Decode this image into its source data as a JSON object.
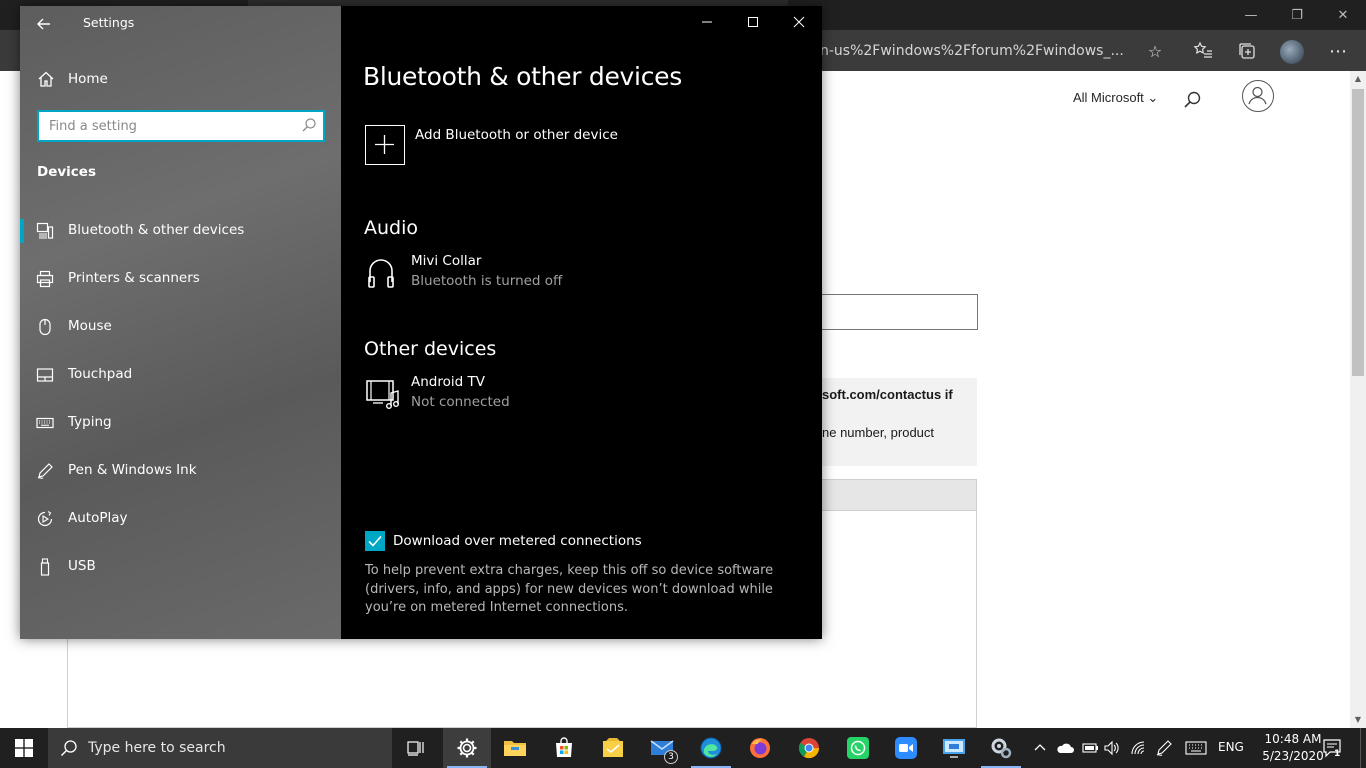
{
  "browser": {
    "address_text": "n-us%2Fwindows%2Fforum%2Fwindows_...",
    "all_microsoft_label": "All Microsoft",
    "notice_line1": "soft.com/contactus if",
    "notice_line2": "ne number, product"
  },
  "settings": {
    "window_title": "Settings",
    "home_label": "Home",
    "search_placeholder": "Find a setting",
    "section_heading": "Devices",
    "nav_items": [
      {
        "label": "Bluetooth & other devices",
        "icon": "bluetooth-devices-icon",
        "active": true
      },
      {
        "label": "Printers & scanners",
        "icon": "printer-icon"
      },
      {
        "label": "Mouse",
        "icon": "mouse-icon"
      },
      {
        "label": "Touchpad",
        "icon": "touchpad-icon"
      },
      {
        "label": "Typing",
        "icon": "keyboard-icon"
      },
      {
        "label": "Pen & Windows Ink",
        "icon": "pen-icon"
      },
      {
        "label": "AutoPlay",
        "icon": "autoplay-icon"
      },
      {
        "label": "USB",
        "icon": "usb-icon"
      }
    ],
    "page_title": "Bluetooth & other devices",
    "add_device_label": "Add Bluetooth or other device",
    "audio_heading": "Audio",
    "audio_devices": [
      {
        "name": "Mivi Collar",
        "status": "Bluetooth is turned off",
        "icon": "headphones-icon"
      }
    ],
    "other_heading": "Other devices",
    "other_devices": [
      {
        "name": "Android TV",
        "status": "Not connected",
        "icon": "media-device-icon"
      }
    ],
    "metered_label": "Download over metered connections",
    "metered_checked": true,
    "metered_help": "To help prevent extra charges, keep this off so device software (drivers, info, and apps) for new devices won’t download while you’re on metered Internet connections.",
    "accent_color": "#00a7c4"
  },
  "taskbar": {
    "search_placeholder": "Type here to search",
    "pinned_apps": [
      {
        "name": "task-view"
      },
      {
        "name": "settings",
        "active": true
      },
      {
        "name": "file-explorer"
      },
      {
        "name": "microsoft-store"
      },
      {
        "name": "sticky-notes"
      },
      {
        "name": "mail",
        "badge": "3"
      },
      {
        "name": "edge",
        "running": true
      },
      {
        "name": "firefox"
      },
      {
        "name": "chrome"
      },
      {
        "name": "whatsapp"
      },
      {
        "name": "zoom"
      },
      {
        "name": "remote-desktop"
      },
      {
        "name": "control-settings"
      }
    ],
    "language": "ENG",
    "time": "10:48 AM",
    "date": "5/23/2020",
    "notification_count": "1"
  }
}
